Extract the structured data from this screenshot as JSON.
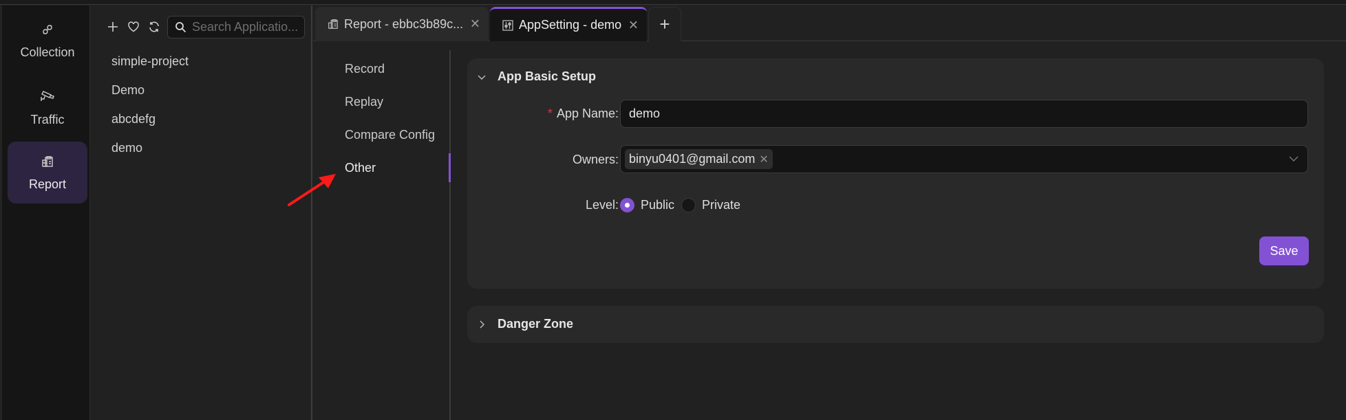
{
  "rail": {
    "items": [
      {
        "label": "Collection",
        "icon": "api-link-icon",
        "active": false
      },
      {
        "label": "Traffic",
        "icon": "camera-icon",
        "active": false
      },
      {
        "label": "Report",
        "icon": "report-icon",
        "active": true
      }
    ]
  },
  "applist": {
    "toolbar": {
      "add_icon": "plus-icon",
      "favorite_icon": "heart-icon",
      "refresh_icon": "refresh-icon"
    },
    "search": {
      "placeholder": "Search Applicatio..."
    },
    "items": [
      "simple-project",
      "Demo",
      "abcdefg",
      "demo"
    ]
  },
  "tabs": {
    "items": [
      {
        "label": "Report - ebbc3b89c...",
        "icon": "report-icon",
        "active": false
      },
      {
        "label": "AppSetting - demo",
        "icon": "settings-sliders-icon",
        "active": true
      }
    ],
    "add_label": "+"
  },
  "setnav": {
    "items": [
      "Record",
      "Replay",
      "Compare Config",
      "Other"
    ],
    "active": "Other"
  },
  "basic_setup": {
    "title": "App Basic Setup",
    "app_name_label": "App Name",
    "app_name_value": "demo",
    "owners_label": "Owners",
    "owners": [
      "binyu0401@gmail.com"
    ],
    "level_label": "Level",
    "level_options": [
      "Public",
      "Private"
    ],
    "level_selected": "Public",
    "save_label": "Save",
    "colon": ":"
  },
  "danger_zone": {
    "title": "Danger Zone"
  },
  "colors": {
    "accent": "#8352d4",
    "required": "#d9363e",
    "annotation": "#ff1a1a"
  }
}
